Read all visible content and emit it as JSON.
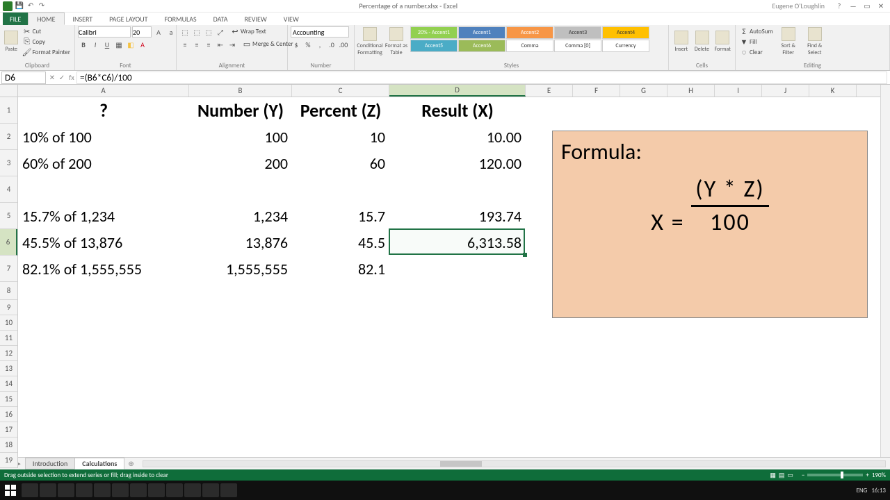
{
  "app": {
    "title": "Percentage of a number.xlsx - Excel",
    "user": "Eugene O'Loughlin"
  },
  "qat": {
    "save": "💾",
    "undo": "↶",
    "redo": "↷"
  },
  "win": {
    "help": "?",
    "min": "—",
    "max": "▭",
    "close": "✕"
  },
  "tabs": {
    "file": "FILE",
    "home": "HOME",
    "insert": "INSERT",
    "layout": "PAGE LAYOUT",
    "formulas": "FORMULAS",
    "data": "DATA",
    "review": "REVIEW",
    "view": "VIEW"
  },
  "ribbon": {
    "clipboard": {
      "label": "Clipboard",
      "paste": "Paste",
      "cut": "Cut",
      "copy": "Copy",
      "painter": "Format Painter"
    },
    "font": {
      "label": "Font",
      "name": "Calibri",
      "size": "20"
    },
    "alignment": {
      "label": "Alignment",
      "wrap": "Wrap Text",
      "merge": "Merge & Center"
    },
    "number": {
      "label": "Number",
      "format": "Accounting"
    },
    "styles": {
      "label": "Styles",
      "cond": "Conditional Formatting",
      "table": "Format as Table",
      "c1": "20% - Accent1",
      "c2": "Accent1",
      "c3": "Accent2",
      "c4": "Accent3",
      "c5": "Accent4",
      "c6": "Accent5",
      "c7": "Accent6",
      "c8": "Comma",
      "c9": "Comma [0]",
      "c10": "Currency"
    },
    "cells": {
      "label": "Cells",
      "insert": "Insert",
      "delete": "Delete",
      "format": "Format"
    },
    "editing": {
      "label": "Editing",
      "sum": "AutoSum",
      "fill": "Fill",
      "clear": "Clear",
      "sort": "Sort & Filter",
      "find": "Find & Select"
    }
  },
  "fbar": {
    "name": "D6",
    "fx": "fx",
    "formula": "=(B6*C6)/100"
  },
  "cols": {
    "A": "A",
    "B": "B",
    "C": "C",
    "D": "D",
    "E": "E",
    "F": "F",
    "G": "G",
    "H": "H",
    "I": "I",
    "J": "J",
    "K": "K"
  },
  "colw": {
    "A": 246,
    "B": 148,
    "C": 140,
    "D": 196,
    "E": 68,
    "F": 68,
    "G": 68,
    "H": 68,
    "I": 68,
    "J": 68,
    "K": 68
  },
  "rows": {
    "r1": "1",
    "r2": "2",
    "r3": "3",
    "r4": "4",
    "r5": "5",
    "r6": "6",
    "r7": "7",
    "r8": "8",
    "r9": "9",
    "r10": "10",
    "r11": "11",
    "r12": "12",
    "r13": "13",
    "r14": "14",
    "r15": "15",
    "r16": "16",
    "r17": "17",
    "r18": "18",
    "r19": "19"
  },
  "rowh": {
    "r1": 38,
    "r2": 38,
    "r3": 38,
    "r4": 38,
    "r5": 38,
    "r6": 38,
    "r7": 38,
    "r8": 26,
    "r9": 22,
    "r10": 22,
    "r11": 22,
    "r12": 22,
    "r13": 22,
    "r14": 22,
    "r15": 22,
    "r16": 22,
    "r17": 22,
    "r18": 22,
    "r19": 22
  },
  "data": {
    "A1": "?",
    "B1": "Number (Y)",
    "C1": "Percent (Z)",
    "D1": "Result (X)",
    "A2": "10% of 100",
    "B2": "100",
    "C2": "10",
    "D2": "10.00",
    "A3": "60% of 200",
    "B3": "200",
    "C3": "60",
    "D3": "120.00",
    "A5": "15.7% of 1,234",
    "B5": "1,234",
    "C5": "15.7",
    "D5": "193.74",
    "A6": "45.5% of 13,876",
    "B6": "13,876",
    "C6": "45.5",
    "D6": "6,313.58",
    "A7": "82.1% of 1,555,555",
    "B7": "1,555,555",
    "C7": "82.1"
  },
  "formula_box": {
    "title": "Formula:",
    "lhs": "X  =  ",
    "num": "(Y  *  Z)",
    "den": "100"
  },
  "sheettabs": {
    "s1": "Introduction",
    "s2": "Calculations"
  },
  "status": {
    "msg": "Drag outside selection to extend series or fill; drag inside to clear",
    "zoom": "190%"
  },
  "tray": {
    "lang": "ENG",
    "time": "16:13"
  },
  "chart_data": {
    "type": "table",
    "title": "Percentage of a number",
    "columns": [
      "?",
      "Number (Y)",
      "Percent (Z)",
      "Result (X)"
    ],
    "rows": [
      [
        "10% of 100",
        100,
        10,
        10.0
      ],
      [
        "60% of 200",
        200,
        60,
        120.0
      ],
      [
        "15.7% of 1,234",
        1234,
        15.7,
        193.74
      ],
      [
        "45.5% of 13,876",
        13876,
        45.5,
        6313.58
      ],
      [
        "82.1% of 1,555,555",
        1555555,
        82.1,
        null
      ]
    ],
    "formula": "X = (Y * Z) / 100"
  }
}
